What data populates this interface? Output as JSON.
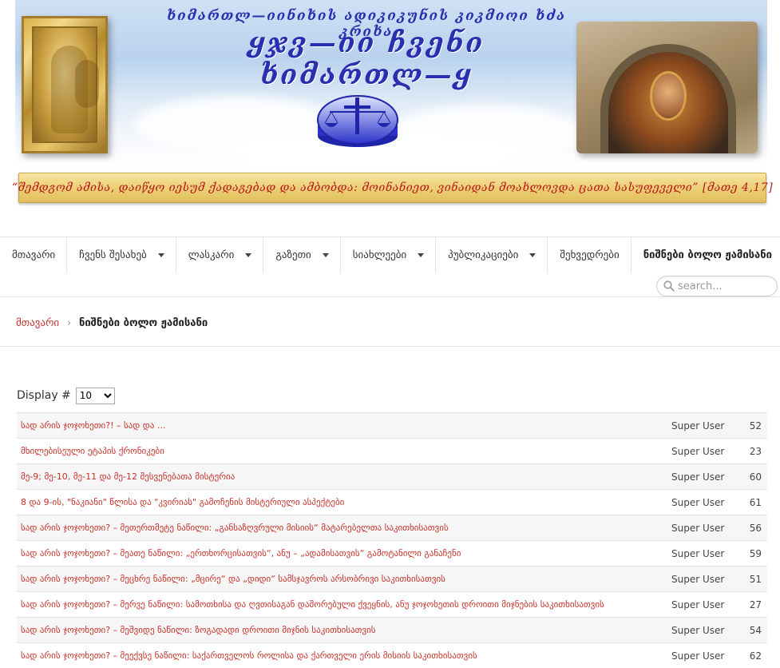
{
  "banner": {
    "small_title": "ხიმართლ—იინიხის ადიკიკუნის კიკმიოი ხძა კრიხა",
    "big_title_line1": "ყჯვ—იი ჩვენი",
    "big_title_line2": "ხიმართლ—ყ",
    "quote": "“შემდგომ ამისა, დაიწყო იესუმ ქადაგებად და ამბობდა: მოინანიეთ, ვინაიდან მოახლოვდა ცათა სასუფეველი”  [მათე 4,17]"
  },
  "nav": {
    "items": [
      {
        "label": "მთავარი",
        "dropdown": false
      },
      {
        "label": "ჩვენს შესახებ",
        "dropdown": true
      },
      {
        "label": "ლასკარი",
        "dropdown": true
      },
      {
        "label": "გაზეთი",
        "dropdown": true
      },
      {
        "label": "სიახლეები",
        "dropdown": true
      },
      {
        "label": "პუბლიკაციები",
        "dropdown": true
      },
      {
        "label": "შეხვედრები",
        "dropdown": false
      },
      {
        "label": "ნიშნები ბოლო ჟამისანი",
        "dropdown": false,
        "active": true
      }
    ],
    "search_placeholder": "search..."
  },
  "breadcrumb": {
    "home": "მთავარი",
    "current": "ნიშნები ბოლო ჟამისანი"
  },
  "display": {
    "label": "Display #",
    "selected": "10"
  },
  "articles": [
    {
      "title": "სად არის ჯოჯოხეთი?! – სად და ...",
      "author": "Super User",
      "hits": "52"
    },
    {
      "title": "მხილებისეული ეტაპის ქრონიკები",
      "author": "Super User",
      "hits": "23"
    },
    {
      "title": "მე-9; მე-10, მე-11 და მე-12 შესვენებათა მისტერია",
      "author": "Super User",
      "hits": "60"
    },
    {
      "title": "8 და 9-ის, \"ნაკიანი\" წლისა და \"კვირიას\" გამოჩენის მისტერიული ასპექტები",
      "author": "Super User",
      "hits": "61"
    },
    {
      "title": "სად არის ჯოჯოხეთი? – მეთერთმეტე ნაწილი: „განსაზღვრული მისიის“ მატარებელთა საკითხისათვის",
      "author": "Super User",
      "hits": "56"
    },
    {
      "title": "სად არის ჯოჯოხეთი? – მეათე ნაწილი: „ერთხორცისათვის“, ანუ – „ადამისათვის“ გამოტანილი განაჩენი",
      "author": "Super User",
      "hits": "59"
    },
    {
      "title": "სად არის ჯოჯოხეთი? – მეცხრე ნაწილი: „მცირე“ და „დიდი“ სამსჯავროს არსობრივი საკითხისათვის",
      "author": "Super User",
      "hits": "51"
    },
    {
      "title": "სად არის ჯოჯოხეთი? – მერვე ნაწილი: სამოთხისა და ღვთისაგან დაშორებული ქვეყნის, ანუ ჯოჯოხეთის დროითი მიჯნების საკითხისათვის",
      "author": "Super User",
      "hits": "27"
    },
    {
      "title": "სად არის ჯოჯოხეთი? – მეშვიდე ნაწილი: ზოგადადი დროითი მიჯნის საკითხისათვის",
      "author": "Super User",
      "hits": "54"
    },
    {
      "title": "სად არის ჯოჯოხეთი? – მეექვსე ნაწილი: საქართველოს როლისა და ქართველი ერის მისიის საკითხისათვის",
      "author": "Super User",
      "hits": "62"
    }
  ]
}
